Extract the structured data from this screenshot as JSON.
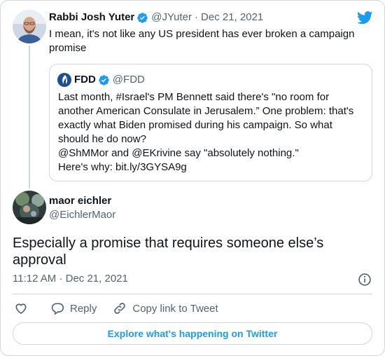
{
  "reply_tweet": {
    "author_name": "Rabbi Josh Yuter",
    "handle": "@JYuter",
    "separator": "·",
    "date": "Dec 21, 2021",
    "text": "I mean, it's not like any US president has ever broken a campaign promise"
  },
  "quoted_tweet": {
    "author_name": "FDD",
    "handle": "@FDD",
    "lines": [
      "Last month, #Israel's PM Bennett said there's \"no room for",
      "another American Consulate in Jerusalem.” One problem: that's",
      "exactly what Biden promised during his campaign. So what",
      "should he do now?",
      "@ShMMor and @EKrivine say \"absolutely nothing.\"",
      "Here's why: bit.ly/3GYSA9g"
    ]
  },
  "main_tweet": {
    "author_name": "maor eichler",
    "handle": "@EichlerMaor",
    "text": "Especially a promise that requires someone else’s approval",
    "time": "11:12 AM",
    "separator": "·",
    "date": "Dec 21, 2021"
  },
  "actions": {
    "reply_label": "Reply",
    "copy_link_label": "Copy link to Tweet"
  },
  "explore_label": "Explore what's happening on Twitter",
  "colors": {
    "accent": "#1d9bf0",
    "muted": "#536471",
    "border": "#cfd9de",
    "text": "#0f1419"
  },
  "icons": [
    "verified-badge-icon",
    "twitter-bird-icon",
    "fdd-logo-icon",
    "info-icon",
    "heart-icon",
    "reply-icon",
    "link-icon"
  ]
}
